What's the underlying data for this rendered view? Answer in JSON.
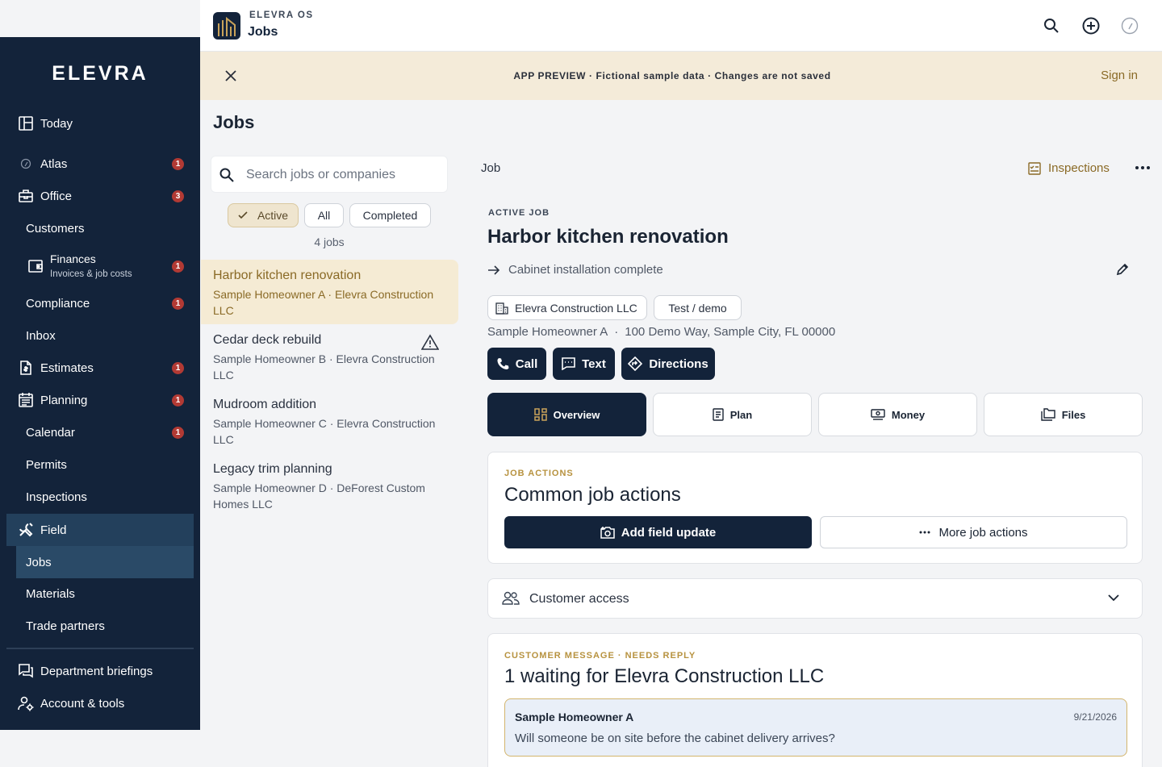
{
  "sidebar": {
    "logo": "ELEVRA",
    "items": [
      {
        "label": "Today",
        "icon": "layout-icon"
      },
      {
        "label": "Atlas",
        "icon": "compass-icon",
        "badge": "1"
      },
      {
        "label": "Office",
        "icon": "briefcase-icon",
        "badge": "3"
      },
      {
        "label": "Customers"
      },
      {
        "label": "Finances",
        "sublabel": "Invoices & job costs",
        "icon": "wallet-icon",
        "badge": "1"
      },
      {
        "label": "Compliance",
        "badge": "1"
      },
      {
        "label": "Inbox"
      },
      {
        "label": "Estimates",
        "icon": "document-dollar-icon",
        "badge": "1"
      },
      {
        "label": "Planning",
        "icon": "calendar-list-icon",
        "badge": "1"
      },
      {
        "label": "Calendar",
        "badge": "1"
      },
      {
        "label": "Permits"
      },
      {
        "label": "Inspections"
      },
      {
        "label": "Field",
        "icon": "tools-icon"
      },
      {
        "label": "Jobs"
      },
      {
        "label": "Materials"
      },
      {
        "label": "Trade partners"
      },
      {
        "label": "Department briefings",
        "icon": "chat-icon"
      },
      {
        "label": "Account & tools",
        "icon": "user-gear-icon"
      }
    ]
  },
  "header": {
    "app_name": "ELEVRA OS",
    "page": "Jobs"
  },
  "banner": {
    "text": "APP PREVIEW · Fictional sample data · Changes are not saved",
    "sign_in": "Sign in"
  },
  "jobs_page": {
    "title": "Jobs",
    "search_placeholder": "Search jobs or companies",
    "filters": [
      "Active",
      "All",
      "Completed"
    ],
    "count": "4 jobs",
    "list": [
      {
        "title": "Harbor kitchen renovation",
        "subtitle": "Sample Homeowner A · Elevra Construction LLC",
        "selected": true
      },
      {
        "title": "Cedar deck rebuild",
        "subtitle": "Sample Homeowner B · Elevra Construction LLC",
        "warning": true
      },
      {
        "title": "Mudroom addition",
        "subtitle": "Sample Homeowner C · Elevra Construction LLC"
      },
      {
        "title": "Legacy trim planning",
        "subtitle": "Sample Homeowner D · DeForest Custom Homes LLC"
      }
    ]
  },
  "detail": {
    "header": "Job",
    "inspections": "Inspections",
    "eyebrow": "ACTIVE JOB",
    "title": "Harbor kitchen renovation",
    "stage": "Cabinet installation complete",
    "company": "Elevra Construction LLC",
    "tag": "Test / demo",
    "customer": "Sample Homeowner A",
    "address": "100 Demo Way, Sample City, FL 00000",
    "contact_buttons": [
      "Call",
      "Text",
      "Directions"
    ],
    "tabs": [
      "Overview",
      "Plan",
      "Money",
      "Files"
    ],
    "actions_card": {
      "eyebrow": "JOB ACTIONS",
      "title": "Common job actions",
      "primary": "Add field update",
      "secondary": "More job actions"
    },
    "customer_access": "Customer access",
    "message_card": {
      "eyebrow": "CUSTOMER MESSAGE · NEEDS REPLY",
      "title": "1 waiting for Elevra Construction LLC",
      "message": {
        "from": "Sample Homeowner A",
        "date": "9/21/2026",
        "text": "Will someone be on site before the cabinet delivery arrives?"
      }
    }
  },
  "colors": {
    "navy": "#13233a",
    "gold": "#8a6a26",
    "badge": "#b23a34",
    "banner": "#f4ebd9"
  }
}
